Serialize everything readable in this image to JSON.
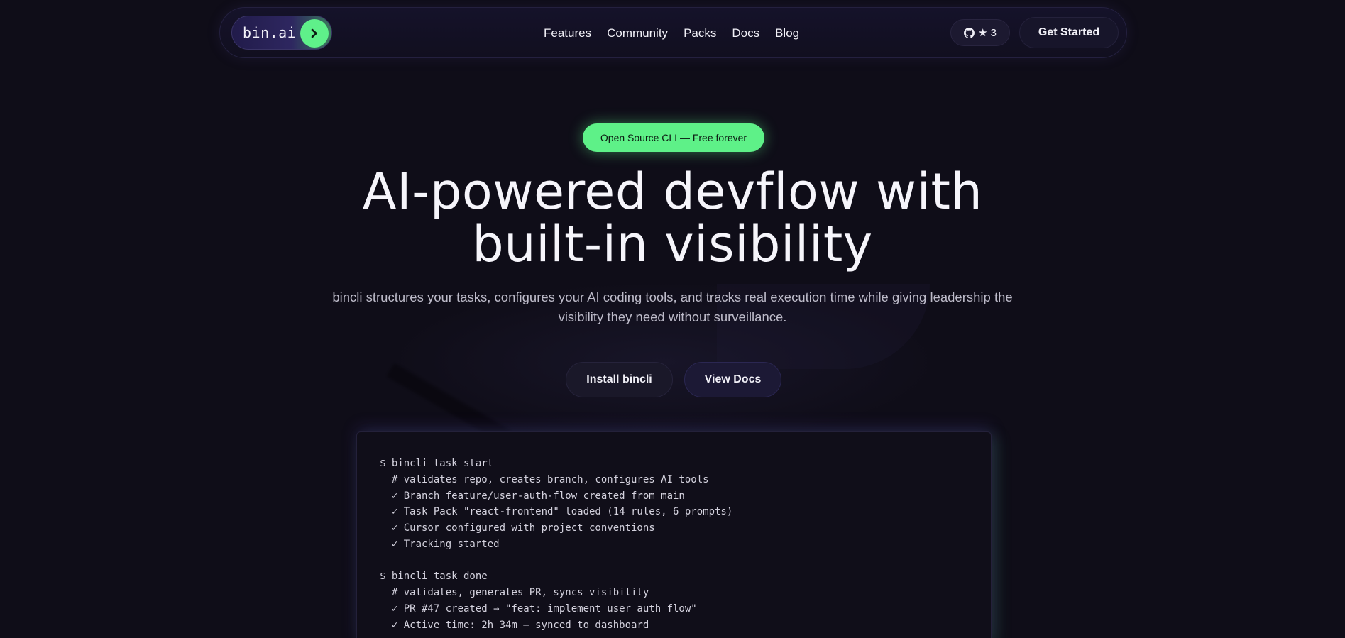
{
  "nav": {
    "logo_text": "bin.ai",
    "links": [
      "Features",
      "Community",
      "Packs",
      "Docs",
      "Blog"
    ],
    "github_stars": "★ 3",
    "get_started_label": "Get Started"
  },
  "hero": {
    "badge": "Open Source CLI — Free forever",
    "title_line1": "AI-powered devflow with",
    "title_line2": "built-in visibility",
    "subtitle_line1": "bincli structures your tasks, configures your AI coding tools, and tracks real execution time while giving leadership the",
    "subtitle_line2": "visibility they need without surveillance.",
    "install_label": "Install bincli",
    "docs_label": "View Docs"
  },
  "terminal": {
    "lines": [
      "$ bincli task start",
      "  # validates repo, creates branch, configures AI tools",
      "  ✓ Branch feature/user-auth-flow created from main",
      "  ✓ Task Pack \"react-frontend\" loaded (14 rules, 6 prompts)",
      "  ✓ Cursor configured with project conventions",
      "  ✓ Tracking started",
      "",
      "$ bincli task done",
      "  # validates, generates PR, syncs visibility",
      "  ✓ PR #47 created → \"feat: implement user auth flow\"",
      "  ✓ Active time: 2h 34m — synced to dashboard"
    ]
  },
  "colors": {
    "background": "#0f0d18",
    "accent_green": "#5ef188",
    "nav_bg": "#15122a"
  }
}
